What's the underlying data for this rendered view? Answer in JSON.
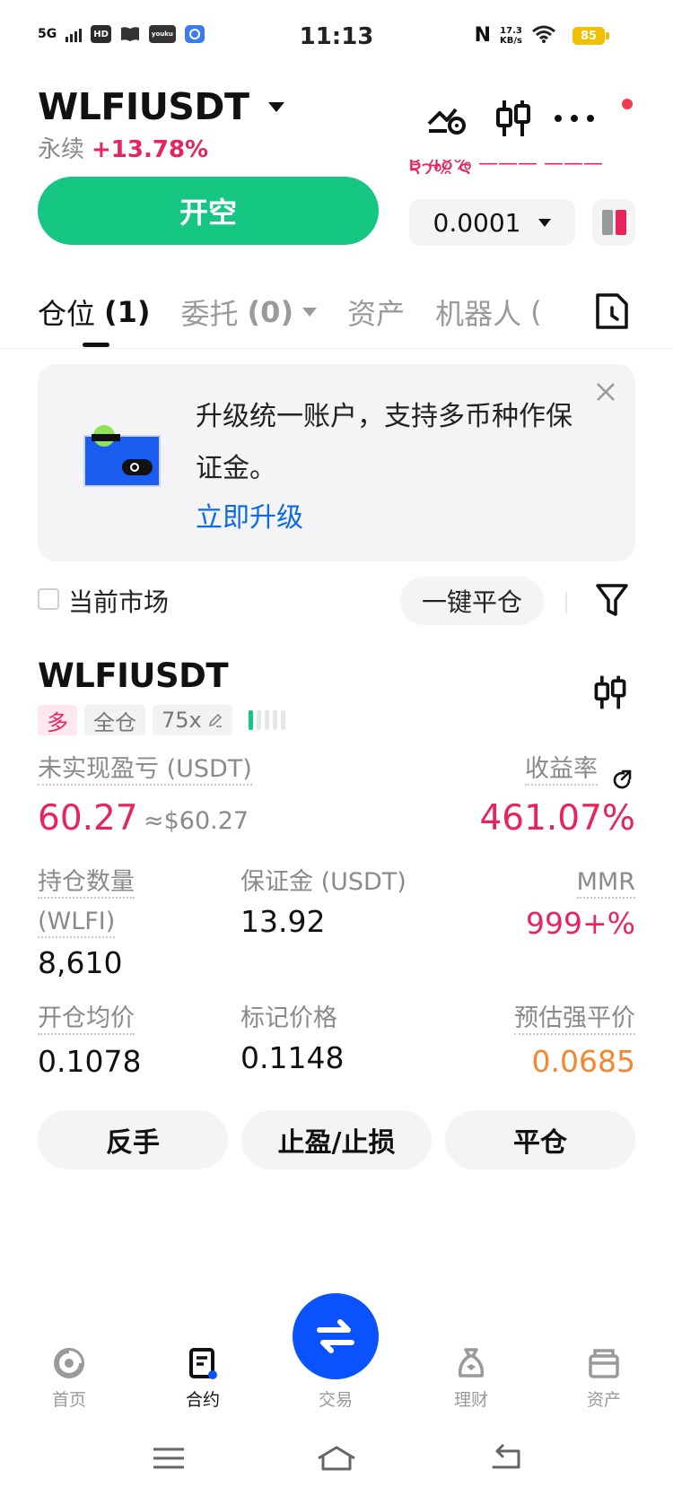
{
  "status_bar": {
    "network": "5G",
    "hd_badge": "HD",
    "app_badge_1": "book-icon",
    "app_badge_2": "youku",
    "app_badge_3": "app-icon",
    "time": "11:13",
    "nfc": "N",
    "speed_value": "17.3",
    "speed_unit": "KB/s",
    "battery": "85"
  },
  "header": {
    "symbol": "WLFIUSDT",
    "contract_type": "永续",
    "change": "+13.78%",
    "orderbook_peek": "B 48% ——— ——— 52% S"
  },
  "actions": {
    "open_short": "开空",
    "precision": "0.0001"
  },
  "tabs": [
    {
      "label": "仓位",
      "count": "(1)"
    },
    {
      "label": "委托",
      "count": "(0)"
    },
    {
      "label": "资产",
      "count": ""
    },
    {
      "label": "机器人",
      "count": "("
    }
  ],
  "banner": {
    "text": "升级统一账户，支持多币种作保证金。",
    "link": "立即升级"
  },
  "filter": {
    "current_market": "当前市场",
    "close_all": "一键平仓"
  },
  "position": {
    "symbol": "WLFIUSDT",
    "side": "多",
    "margin_mode": "全仓",
    "leverage": "75x",
    "adl_level": 1,
    "unrealized_pnl_label": "未实现盈亏 (USDT)",
    "unrealized_pnl": "60.27",
    "unrealized_pnl_usd": "≈$60.27",
    "roe_label": "收益率",
    "roe": "461.07%",
    "size_label_1": "持仓数量",
    "size_label_2": "(WLFI)",
    "size": "8,610",
    "margin_label": "保证金 (USDT)",
    "margin": "13.92",
    "mmr_label": "MMR",
    "mmr": "999+%",
    "entry_label": "开仓均价",
    "entry": "0.1078",
    "mark_label": "标记价格",
    "mark": "0.1148",
    "liq_label": "预估强平价",
    "liq": "0.0685"
  },
  "position_actions": {
    "reverse": "反手",
    "tp_sl": "止盈/止损",
    "close": "平仓"
  },
  "bottom_nav": [
    {
      "label": "首页",
      "icon": "home-icon"
    },
    {
      "label": "合约",
      "icon": "futures-icon"
    },
    {
      "label": "交易",
      "icon": "trade-swap-icon"
    },
    {
      "label": "理财",
      "icon": "earn-icon"
    },
    {
      "label": "资产",
      "icon": "wallet-icon"
    }
  ],
  "colors": {
    "green": "#16c784",
    "red": "#e8245b",
    "orange": "#f5862b",
    "blue": "#0b52ff",
    "link": "#0b6ae8"
  }
}
